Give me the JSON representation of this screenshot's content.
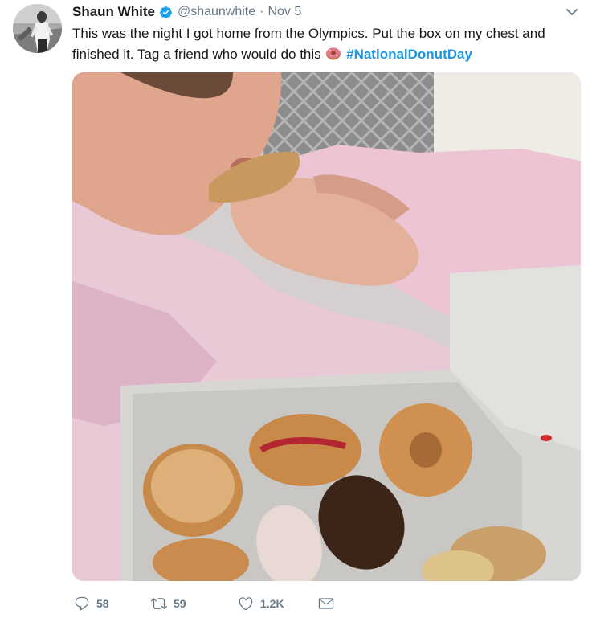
{
  "tweet": {
    "author": {
      "display_name": "Shaun White",
      "handle": "@shaunwhite",
      "verified": true
    },
    "separator": "·",
    "timestamp": "Nov 5",
    "text_before": "This was the night I got home from the Olympics. Put the box on my chest and finished it. Tag a friend who would do this ",
    "emoji": "doughnut",
    "hashtag": "#NationalDonutDay",
    "media": {
      "description": "Man in pink hoodie eating a donut with an open box of donuts on his chest"
    },
    "actions": {
      "reply_count": "58",
      "retweet_count": "59",
      "like_count": "1.2K"
    }
  },
  "colors": {
    "accent": "#1b95e0",
    "secondary_text": "#657786",
    "primary_text": "#14171a"
  },
  "icons": [
    "verified-badge-icon",
    "chevron-down-icon",
    "doughnut-emoji-icon",
    "reply-icon",
    "retweet-icon",
    "heart-icon",
    "direct-message-icon"
  ]
}
